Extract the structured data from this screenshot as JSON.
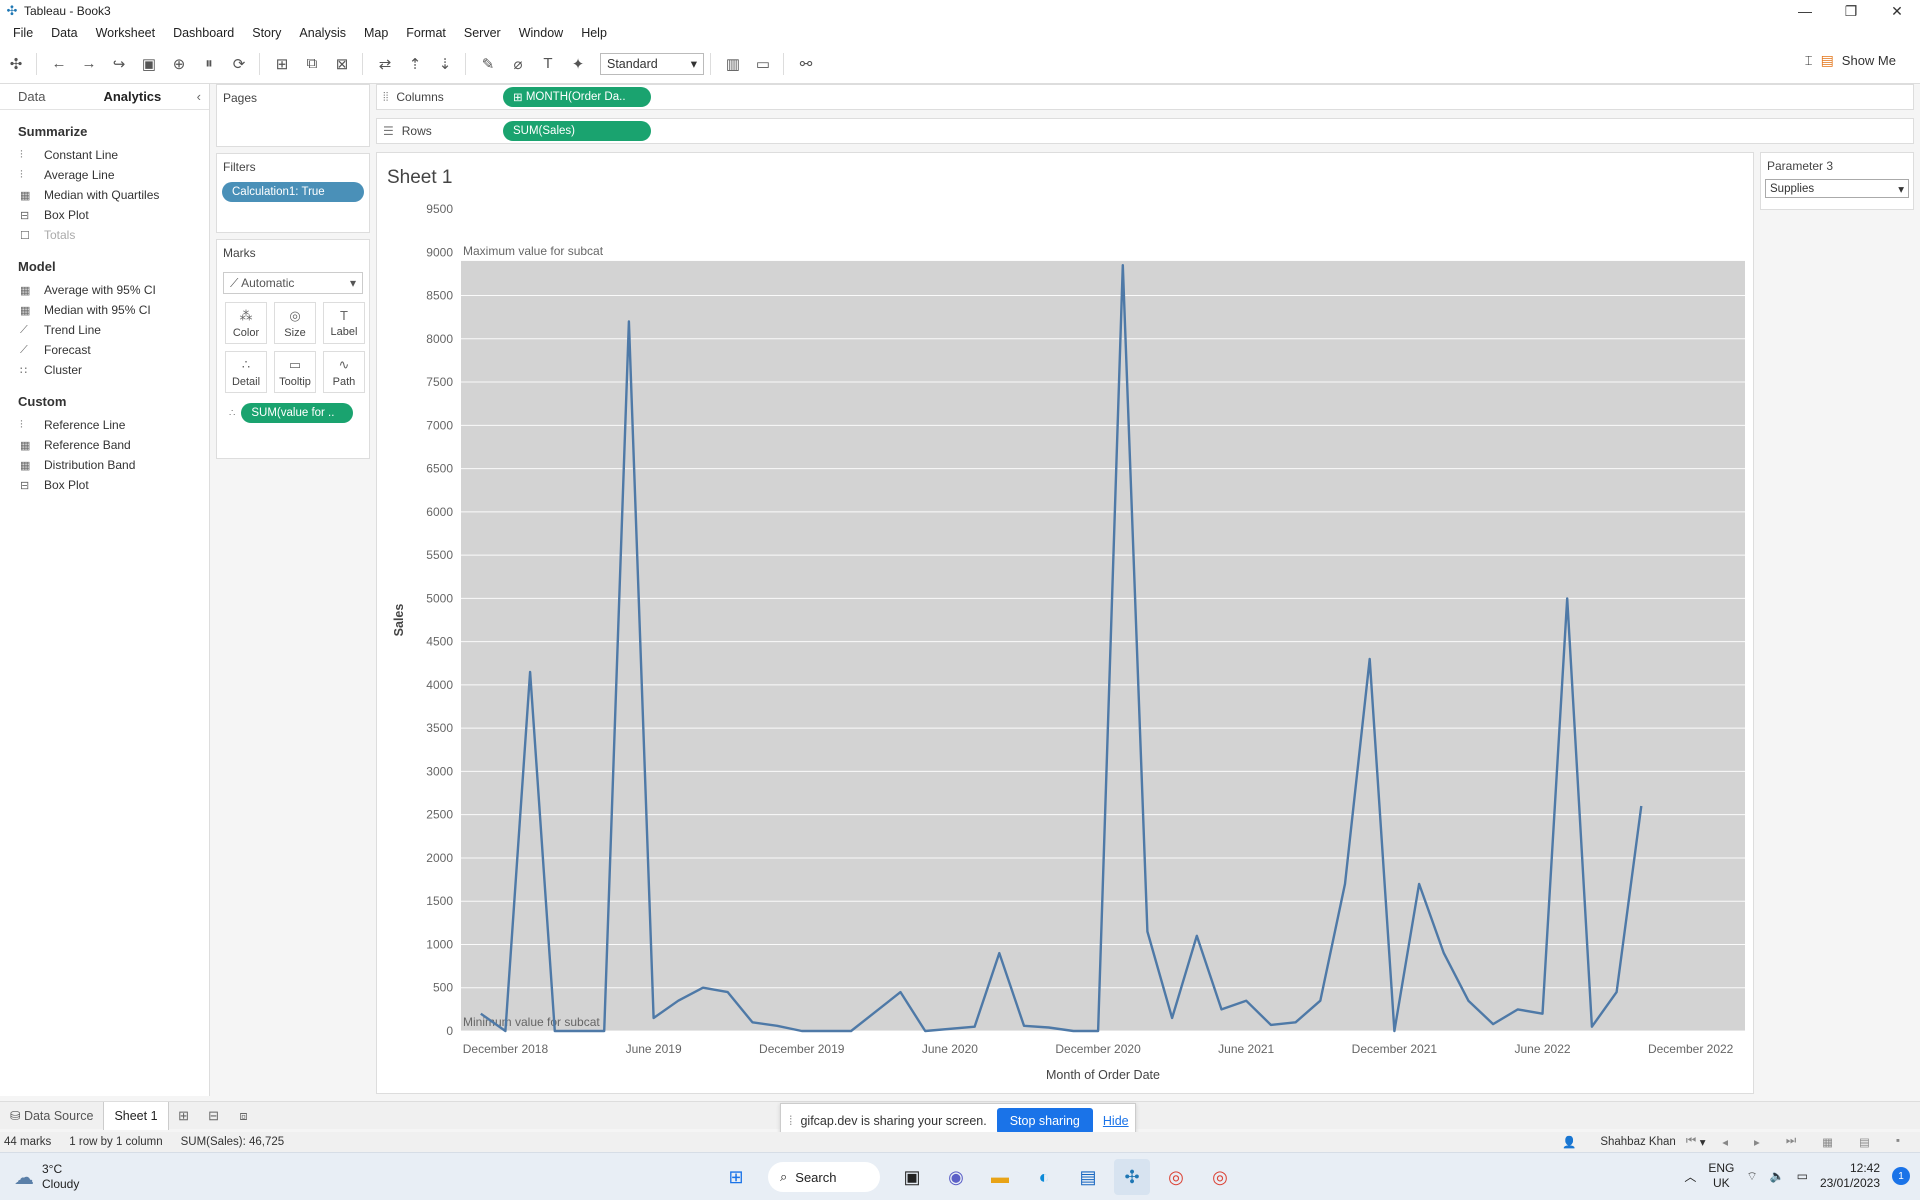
{
  "window": {
    "title": "Tableau - Book3"
  },
  "menu": [
    "File",
    "Data",
    "Worksheet",
    "Dashboard",
    "Story",
    "Analysis",
    "Map",
    "Format",
    "Server",
    "Window",
    "Help"
  ],
  "toolbar": {
    "fit_select": "Standard",
    "show_me": "Show Me"
  },
  "left_pane": {
    "tabs": [
      "Data",
      "Analytics"
    ],
    "summarize": {
      "title": "Summarize",
      "items": [
        "Constant Line",
        "Average Line",
        "Median with Quartiles",
        "Box Plot",
        "Totals"
      ]
    },
    "model": {
      "title": "Model",
      "items": [
        "Average with 95% CI",
        "Median with 95% CI",
        "Trend Line",
        "Forecast",
        "Cluster"
      ]
    },
    "custom": {
      "title": "Custom",
      "items": [
        "Reference Line",
        "Reference Band",
        "Distribution Band",
        "Box Plot"
      ]
    }
  },
  "pages": {
    "title": "Pages"
  },
  "filters": {
    "title": "Filters",
    "pill": "Calculation1: True"
  },
  "marks": {
    "title": "Marks",
    "type": "Automatic",
    "buttons": [
      "Color",
      "Size",
      "Label",
      "Detail",
      "Tooltip",
      "Path"
    ],
    "pill": "SUM(value for .."
  },
  "shelves": {
    "columns_label": "Columns",
    "columns_pill": "MONTH(Order Da..",
    "rows_label": "Rows",
    "rows_pill": "SUM(Sales)"
  },
  "sheet": {
    "title": "Sheet 1"
  },
  "parameter": {
    "title": "Parameter 3",
    "value": "Supplies"
  },
  "chart_data": {
    "type": "line",
    "xlabel": "Month of Order Date",
    "ylabel": "Sales",
    "ylim": [
      0,
      9500
    ],
    "yticks": [
      0,
      500,
      1000,
      1500,
      2000,
      2500,
      3000,
      3500,
      4000,
      4500,
      5000,
      5500,
      6000,
      6500,
      7000,
      7500,
      8000,
      8500,
      9000,
      9500
    ],
    "xtick_labels": [
      "December 2018",
      "June 2019",
      "December 2019",
      "June 2020",
      "December 2020",
      "June 2021",
      "December 2021",
      "June 2022",
      "December 2022"
    ],
    "x": [
      "2018-11",
      "2018-12",
      "2019-01",
      "2019-02",
      "2019-03",
      "2019-04",
      "2019-05",
      "2019-06",
      "2019-07",
      "2019-08",
      "2019-09",
      "2019-10",
      "2019-11",
      "2019-12",
      "2020-02",
      "2020-04",
      "2020-05",
      "2020-07",
      "2020-08",
      "2020-09",
      "2020-10",
      "2020-11",
      "2020-12",
      "2021-01",
      "2021-02",
      "2021-03",
      "2021-04",
      "2021-05",
      "2021-06",
      "2021-07",
      "2021-08",
      "2021-09",
      "2021-10",
      "2021-11",
      "2021-12",
      "2022-01",
      "2022-02",
      "2022-03",
      "2022-04",
      "2022-05",
      "2022-06",
      "2022-07",
      "2022-08",
      "2022-09",
      "2022-10",
      "2022-11",
      "2022-12"
    ],
    "values": [
      200,
      0,
      4150,
      0,
      0,
      0,
      8200,
      150,
      350,
      500,
      450,
      100,
      60,
      0,
      0,
      450,
      0,
      50,
      900,
      60,
      40,
      0,
      0,
      8850,
      1150,
      150,
      1100,
      250,
      350,
      70,
      100,
      350,
      1700,
      4300,
      0,
      1700,
      900,
      350,
      80,
      250,
      200,
      5000,
      50,
      450,
      2600
    ],
    "reference_band": {
      "min_label": "Minimum value for subcat",
      "max_label": "Maximum value for subcat",
      "min": 0,
      "max": 8900
    },
    "grid": true,
    "line_color": "#4e79a7",
    "band_color": "#d3d3d3"
  },
  "sheet_tabs": {
    "data_source": "Data Source",
    "sheet": "Sheet 1"
  },
  "share_bar": {
    "message": "gifcap.dev is sharing your screen.",
    "stop": "Stop sharing",
    "hide": "Hide"
  },
  "status": {
    "marks": "44 marks",
    "dims": "1 row by 1 column",
    "sum": "SUM(Sales): 46,725",
    "user": "Shahbaz Khan"
  },
  "taskbar": {
    "temp": "3°C",
    "weather": "Cloudy",
    "search": "Search",
    "lang_top": "ENG",
    "lang_bottom": "UK",
    "time": "12:42",
    "date": "23/01/2023",
    "notifications": "1"
  }
}
